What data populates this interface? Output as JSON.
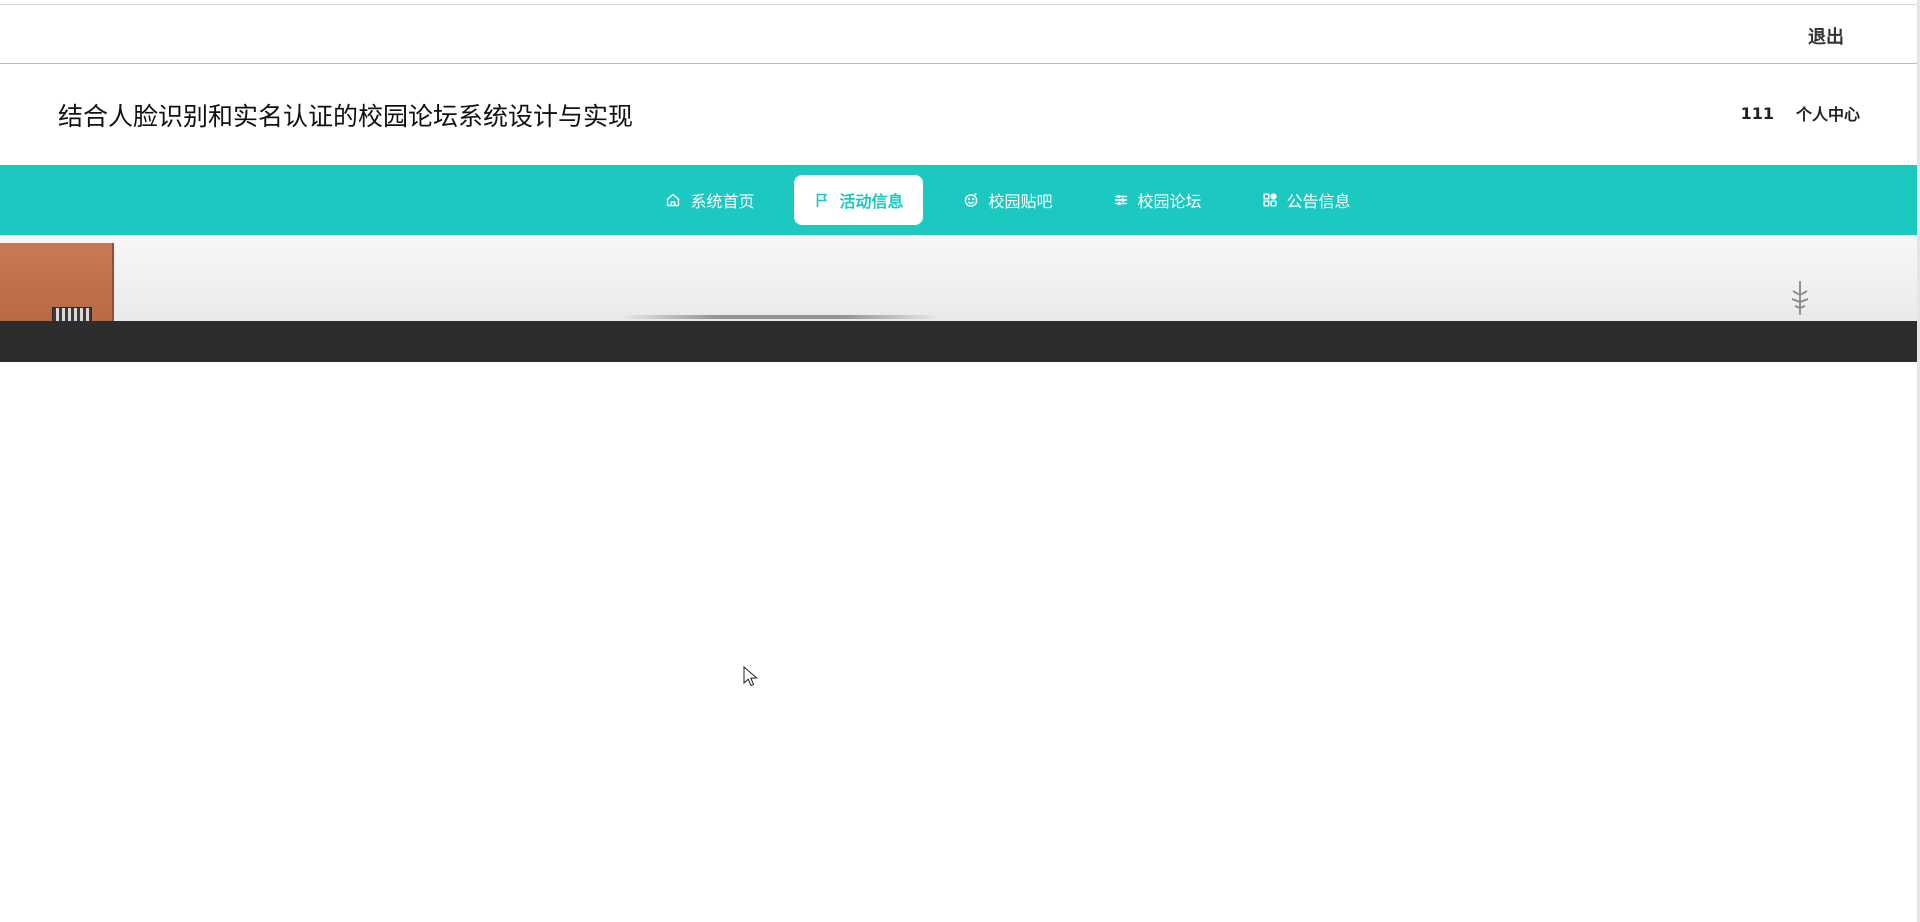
{
  "topbar": {
    "logout_label": "退出"
  },
  "header": {
    "title": "结合人脸识别和实名认证的校园论坛系统设计与实现",
    "username": "111",
    "user_center_label": "个人中心"
  },
  "nav": {
    "items": [
      {
        "label": "系统首页",
        "icon": "home-icon",
        "active": false
      },
      {
        "label": "活动信息",
        "icon": "flag-icon",
        "active": true
      },
      {
        "label": "校园贴吧",
        "icon": "smile-icon",
        "active": false
      },
      {
        "label": "校园论坛",
        "icon": "sliders-icon",
        "active": false
      },
      {
        "label": "公告信息",
        "icon": "grid-icon",
        "active": false
      }
    ]
  },
  "colors": {
    "nav_background": "#1cc9c0",
    "active_text": "#1cc9c0",
    "footer": "#2d2d2d"
  }
}
